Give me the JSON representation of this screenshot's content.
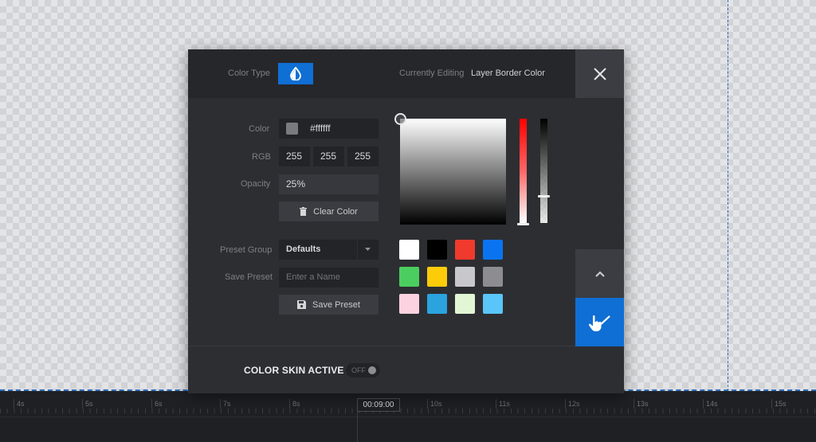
{
  "header": {
    "color_type_label": "Color Type",
    "color_type_icon": "droplet-half-icon",
    "currently_editing_label": "Currently Editing",
    "currently_editing_value": "Layer Border Color",
    "close_icon": "close-icon"
  },
  "form": {
    "color_label": "Color",
    "color_value": "#ffffff",
    "rgb_label": "RGB",
    "rgb": {
      "r": "255",
      "g": "255",
      "b": "255"
    },
    "opacity_label": "Opacity",
    "opacity_value": "25%",
    "clear_color_label": "Clear Color",
    "clear_color_icon": "trash-icon",
    "preset_group_label": "Preset Group",
    "preset_group_value": "Defaults",
    "save_preset_label": "Save Preset",
    "save_preset_placeholder": "Enter a Name",
    "save_preset_button": "Save Preset",
    "save_preset_icon": "floppy-disk-icon"
  },
  "picker": {
    "hue_color": "#ff0000",
    "alpha_fraction": 0.25
  },
  "presets": [
    "#ffffff",
    "#000000",
    "#f03a2e",
    "#0a74f0",
    "#4ccd5f",
    "#fccb0a",
    "#c8c8cc",
    "#8c8c91",
    "#fdd2e0",
    "#2aa3df",
    "#e2f6d6",
    "#5ac5f8"
  ],
  "side": {
    "up_icon": "chevron-up-icon",
    "apply_icon": "hand-pointer-check-icon"
  },
  "footer": {
    "skin_label": "COLOR SKIN ACTIVE",
    "toggle_text": "OFF"
  },
  "timeline": {
    "ticks": [
      "4s",
      "5s",
      "6s",
      "7s",
      "8s",
      "10s",
      "11s",
      "12s",
      "13s",
      "14s",
      "15s"
    ],
    "current_time": "00:09:00"
  },
  "colors": {
    "accent": "#0f6fd4",
    "modal_bg": "#2d2e32",
    "header_bg": "#26272a"
  }
}
